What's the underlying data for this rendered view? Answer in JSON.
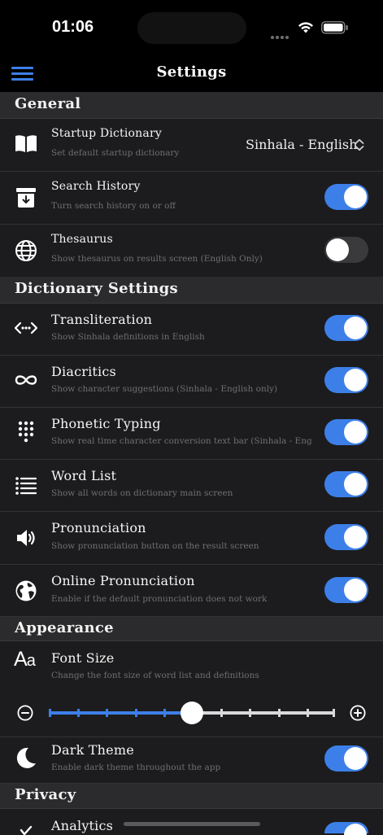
{
  "status": {
    "time": "01:06"
  },
  "nav": {
    "title": "Settings"
  },
  "colors": {
    "accent": "#3d7fe8",
    "background": "#1c1c1e",
    "section": "#2b2b2d"
  },
  "sections": {
    "general": "General",
    "dictionary": "Dictionary Settings",
    "appearance": "Appearance",
    "privacy": "Privacy"
  },
  "general": {
    "startup": {
      "title": "Startup Dictionary",
      "sub": "Set default startup dictionary",
      "value": "Sinhala - English",
      "icon": "book-icon"
    },
    "history": {
      "title": "Search History",
      "sub": "Turn search history on or off",
      "on": true,
      "icon": "archive-download-icon"
    },
    "thesaurus": {
      "title": "Thesaurus",
      "sub": "Show thesaurus on results screen (English Only)",
      "on": false,
      "icon": "globe-icon"
    }
  },
  "dictionary": {
    "transliteration": {
      "title": "Transliteration",
      "sub": "Show Sinhala definitions in English",
      "on": true,
      "icon": "code-arrows-icon"
    },
    "diacritics": {
      "title": "Diacritics",
      "sub": "Show character suggestions (Sinhala - English only)",
      "on": true,
      "icon": "infinity-icon"
    },
    "phonetic": {
      "title": "Phonetic Typing",
      "sub": "Show real time character conversion text bar (Sinhala - English on",
      "on": true,
      "icon": "keypad-icon"
    },
    "wordlist": {
      "title": "Word List",
      "sub": "Show all words on dictionary main screen",
      "on": true,
      "icon": "list-icon"
    },
    "pronunciation": {
      "title": "Pronunciation",
      "sub": "Show pronunciation button on the result screen",
      "on": true,
      "icon": "speaker-icon"
    },
    "online": {
      "title": "Online Pronunciation",
      "sub": "Enable if the default pronunciation does not work",
      "on": true,
      "icon": "earth-icon"
    }
  },
  "appearance": {
    "fontsize": {
      "title": "Font Size",
      "sub": "Change the font size of word list and definitions",
      "icon": "text-size-icon",
      "value": 5,
      "min": 0,
      "max": 10
    },
    "dark": {
      "title": "Dark Theme",
      "sub": "Enable dark theme throughout the app",
      "on": true,
      "icon": "moon-icon"
    }
  },
  "privacy": {
    "analytics": {
      "title": "Analytics",
      "on": true,
      "icon": "check-icon"
    }
  }
}
